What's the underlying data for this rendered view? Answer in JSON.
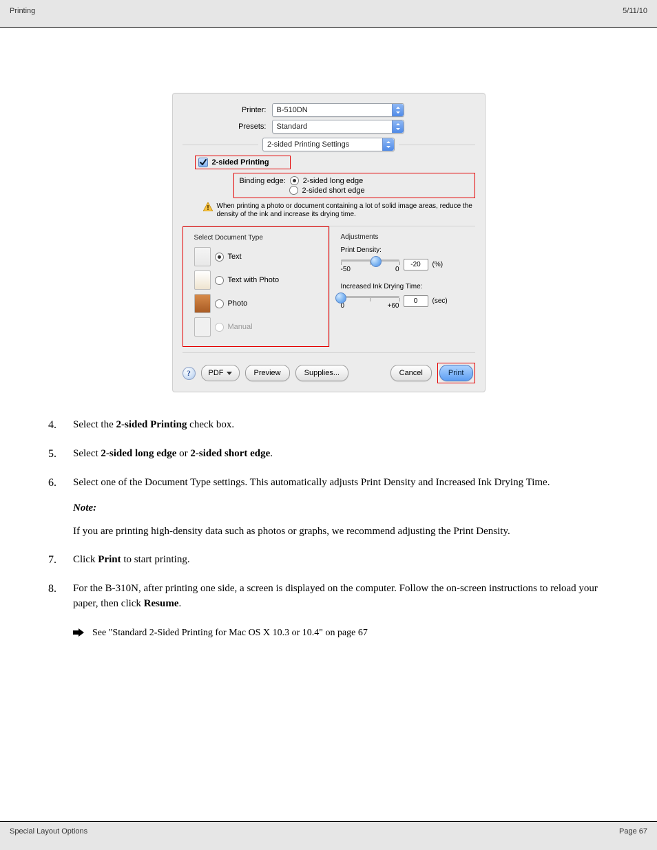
{
  "header": {
    "left": "Printing",
    "right": "5/11/10"
  },
  "footer": {
    "left": "Special Layout Options",
    "right": "Page 67"
  },
  "dialog": {
    "printerLabel": "Printer:",
    "printerValue": "B-510DN",
    "presetsLabel": "Presets:",
    "presetsValue": "Standard",
    "panelValue": "2-sided Printing Settings",
    "twoSidedCheckboxLabel": "2-sided Printing",
    "bindingEdgeLabel": "Binding edge:",
    "bindingLong": "2-sided long edge",
    "bindingShort": "2-sided short edge",
    "warning": "When printing a photo or document containing a lot of solid image areas, reduce the density of the ink and increase its drying time.",
    "docTypeTitle": "Select Document Type",
    "docTypes": {
      "text": "Text",
      "textWithPhoto": "Text with Photo",
      "photo": "Photo",
      "manual": "Manual"
    },
    "adjustmentsTitle": "Adjustments",
    "printDensityLabel": "Print Density:",
    "printDensityMin": "-50",
    "printDensityMax": "0",
    "printDensityValue": "-20",
    "printDensityUnit": "(%)",
    "dryTimeLabel": "Increased Ink Drying Time:",
    "dryTimeMin": "0",
    "dryTimeMax": "+60",
    "dryTimeValue": "0",
    "dryTimeUnit": "(sec)",
    "pdfLabel": "PDF",
    "previewLabel": "Preview",
    "suppliesLabel": "Supplies...",
    "cancelLabel": "Cancel",
    "printLabel": "Print"
  },
  "body": {
    "step4": {
      "num": "4.",
      "textA": "Select the ",
      "bold1": "2-sided Printing",
      "textB": " check box."
    },
    "step5": {
      "num": "5.",
      "textA": "Select ",
      "bold1": "2-sided long edge",
      "textB": " or ",
      "bold2": "2-sided short edge",
      "textC": "."
    },
    "step6": {
      "num": "6.",
      "textA": "Select one of the Document Type settings. This automatically adjusts Print Density and Increased Ink Drying Time.",
      "noteLabel": "Note:",
      "noteBody": "If you are printing high-density data such as photos or graphs, we recommend adjusting the Print Density."
    },
    "step7": {
      "num": "7.",
      "textA": "Click ",
      "bold1": "Print",
      "textB": " to start printing."
    },
    "step8": {
      "num": "8.",
      "textA": "For the B-310N, after printing one side, a screen is displayed on the computer. Follow the on-screen instructions to reload your paper, then click ",
      "bold1": "Resume",
      "textB": "."
    },
    "seeRef": "See \"Standard 2-Sided Printing for Mac OS X 10.3 or 10.4\" on page 67"
  }
}
